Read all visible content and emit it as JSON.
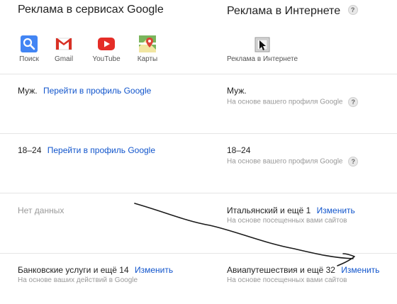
{
  "left": {
    "title": "Реклама в сервисах Google",
    "services": [
      {
        "label": "Поиск",
        "icon": "search-icon"
      },
      {
        "label": "Gmail",
        "icon": "gmail-icon"
      },
      {
        "label": "YouTube",
        "icon": "youtube-icon"
      },
      {
        "label": "Карты",
        "icon": "maps-icon"
      }
    ]
  },
  "right": {
    "title": "Реклама в Интернете",
    "help": "?",
    "web_label": "Реклама в Интернете"
  },
  "rows": [
    {
      "left_value": "Муж.",
      "left_link": "Перейти в профиль Google",
      "right_value": "Муж.",
      "right_sub": "На основе вашего профиля Google",
      "help": "?"
    },
    {
      "left_value": "18–24",
      "left_link": "Перейти в профиль Google",
      "right_value": "18–24",
      "right_sub": "На основе вашего профиля Google",
      "help": "?"
    },
    {
      "left_value": "Нет данных",
      "right_value": "Итальянский и ещё 1",
      "right_link": "Изменить",
      "right_sub": "На основе посещенных вами сайтов"
    },
    {
      "left_value": "Банковские услуги и ещё 14",
      "left_link": "Изменить",
      "left_sub": "На основе ваших действий в Google",
      "right_value": "Авиапутешествия и ещё 32",
      "right_link": "Изменить",
      "right_sub": "На основе посещенных вами сайтов"
    }
  ],
  "colors": {
    "link": "#1155cc",
    "muted": "#999999",
    "divider": "#e5e5e5"
  }
}
